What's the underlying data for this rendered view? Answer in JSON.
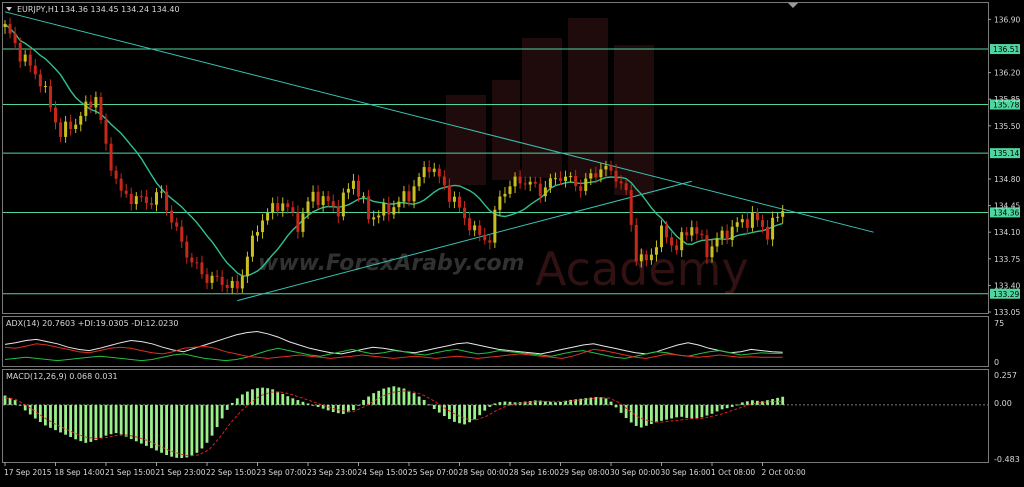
{
  "chart_data": [
    {
      "type": "candlestick",
      "title": "EURJPY,H1",
      "ohlc_readout": "134.36 134.45 134.24 134.40",
      "ylim": [
        133.05,
        137.05
      ],
      "y_ticks": [
        "136.90",
        "136.51",
        "136.20",
        "135.85",
        "135.78",
        "135.50",
        "135.14",
        "134.80",
        "134.45",
        "134.36",
        "134.10",
        "133.75",
        "133.40",
        "133.29",
        "133.05"
      ],
      "x_ticks": [
        "17 Sep 2015",
        "18 Sep 14:00",
        "21 Sep 15:00",
        "21 Sep 23:00",
        "22 Sep 15:00",
        "23 Sep 07:00",
        "23 Sep 23:00",
        "24 Sep 15:00",
        "25 Sep 07:00",
        "28 Sep 00:00",
        "28 Sep 16:00",
        "29 Sep 08:00",
        "30 Sep 00:00",
        "30 Sep 16:00",
        "1 Oct 08:00",
        "2 Oct 00:00"
      ],
      "horizontal_levels": [
        {
          "value": 136.51,
          "label": "136.51"
        },
        {
          "value": 135.78,
          "label": "135.78"
        },
        {
          "value": 135.14,
          "label": "135.14"
        },
        {
          "value": 134.36,
          "label": "134.36"
        },
        {
          "value": 133.29,
          "label": "133.29"
        }
      ],
      "trendlines": [
        {
          "from": [
            0,
            137.0
          ],
          "to": [
            172,
            134.1
          ]
        },
        {
          "from": [
            46,
            133.2
          ],
          "to": [
            136,
            134.77
          ]
        }
      ],
      "price_path": [
        [
          0,
          136.8
        ],
        [
          3,
          136.45
        ],
        [
          7,
          136.1
        ],
        [
          11,
          135.4
        ],
        [
          14,
          135.55
        ],
        [
          18,
          135.9
        ],
        [
          20,
          135.2
        ],
        [
          23,
          134.6
        ],
        [
          28,
          134.5
        ],
        [
          31,
          134.6
        ],
        [
          34,
          134.1
        ],
        [
          37,
          133.7
        ],
        [
          40,
          133.5
        ],
        [
          43,
          133.45
        ],
        [
          46,
          133.35
        ],
        [
          48,
          133.8
        ],
        [
          51,
          134.3
        ],
        [
          55,
          134.5
        ],
        [
          58,
          134.2
        ],
        [
          61,
          134.6
        ],
        [
          66,
          134.4
        ],
        [
          69,
          134.8
        ],
        [
          72,
          134.3
        ],
        [
          76,
          134.4
        ],
        [
          80,
          134.6
        ],
        [
          84,
          135.0
        ],
        [
          87,
          134.7
        ],
        [
          90,
          134.4
        ],
        [
          93,
          134.1
        ],
        [
          96,
          134.0
        ],
        [
          98,
          134.6
        ],
        [
          102,
          134.8
        ],
        [
          106,
          134.65
        ],
        [
          110,
          134.85
        ],
        [
          114,
          134.7
        ],
        [
          118,
          134.95
        ],
        [
          121,
          134.85
        ],
        [
          123,
          134.6
        ],
        [
          125,
          133.8
        ],
        [
          127,
          133.7
        ],
        [
          130,
          134.1
        ],
        [
          133,
          133.9
        ],
        [
          136,
          134.2
        ],
        [
          139,
          133.85
        ],
        [
          141,
          134.0
        ],
        [
          145,
          134.2
        ],
        [
          148,
          134.3
        ],
        [
          151,
          134.1
        ],
        [
          153,
          134.3
        ],
        [
          154,
          134.4
        ]
      ],
      "colors": {
        "up": "#c9c020",
        "down": "#c8281c",
        "ma": "#30c090",
        "levels": "#4fd6a0",
        "trend": "#3cc2b5"
      },
      "watermark_lines": [
        "www.ForexAraby.com",
        "Academy"
      ]
    },
    {
      "type": "line",
      "title": "ADX(14) 20.7603 +DI:19.0305 -DI:12.0230",
      "ylim": [
        0,
        75
      ],
      "y_ticks": [
        "75",
        "0"
      ],
      "series": [
        {
          "name": "ADX",
          "color": "#e8e8e8",
          "values": [
            35,
            38,
            42,
            44,
            40,
            36,
            30,
            26,
            24,
            28,
            33,
            38,
            42,
            40,
            36,
            30,
            25,
            22,
            28,
            34,
            40,
            46,
            52,
            56,
            58,
            54,
            48,
            40,
            34,
            28,
            24,
            20,
            18,
            22,
            26,
            30,
            28,
            25,
            22,
            20,
            24,
            28,
            32,
            36,
            38,
            34,
            30,
            26,
            24,
            22,
            20,
            18,
            22,
            26,
            30,
            34,
            36,
            32,
            28,
            24,
            20,
            18,
            22,
            28,
            34,
            38,
            34,
            28,
            24,
            20,
            22,
            26,
            24,
            22,
            21
          ]
        },
        {
          "name": "+DI",
          "color": "#20c040",
          "values": [
            8,
            10,
            12,
            10,
            8,
            6,
            8,
            10,
            12,
            14,
            12,
            10,
            8,
            6,
            8,
            12,
            16,
            18,
            14,
            10,
            8,
            6,
            8,
            12,
            18,
            24,
            28,
            24,
            20,
            16,
            14,
            18,
            22,
            26,
            22,
            18,
            20,
            24,
            22,
            18,
            16,
            20,
            24,
            26,
            22,
            18,
            20,
            24,
            22,
            20,
            18,
            16,
            14,
            18,
            22,
            24,
            20,
            16,
            12,
            10,
            14,
            18,
            22,
            20,
            16,
            14,
            18,
            22,
            24,
            20,
            16,
            18,
            20,
            19,
            19
          ]
        },
        {
          "name": "-DI",
          "color": "#e03020",
          "values": [
            30,
            28,
            32,
            36,
            34,
            30,
            26,
            22,
            20,
            24,
            28,
            30,
            28,
            24,
            20,
            18,
            22,
            28,
            30,
            32,
            28,
            22,
            18,
            14,
            12,
            10,
            12,
            14,
            16,
            14,
            12,
            10,
            12,
            14,
            16,
            14,
            12,
            10,
            12,
            14,
            12,
            10,
            12,
            14,
            12,
            10,
            12,
            14,
            16,
            18,
            16,
            14,
            12,
            10,
            14,
            20,
            26,
            24,
            20,
            16,
            12,
            10,
            14,
            18,
            16,
            14,
            12,
            14,
            16,
            14,
            12,
            13,
            12,
            12,
            12
          ]
        }
      ]
    },
    {
      "type": "bar",
      "title": "MACD(12,26,9) 0.068 0.031",
      "ylim": [
        -0.483,
        0.257
      ],
      "y_ticks": [
        "0.257",
        "0.00",
        "-0.483"
      ],
      "series": [
        {
          "name": "MACD",
          "color": "#9cf08c",
          "values": [
            0.08,
            0.04,
            -0.05,
            -0.12,
            -0.18,
            -0.22,
            -0.26,
            -0.3,
            -0.33,
            -0.3,
            -0.26,
            -0.24,
            -0.28,
            -0.32,
            -0.36,
            -0.4,
            -0.44,
            -0.46,
            -0.45,
            -0.4,
            -0.3,
            -0.15,
            0.0,
            0.08,
            0.13,
            0.15,
            0.14,
            0.1,
            0.06,
            0.03,
            0.0,
            -0.03,
            -0.06,
            -0.08,
            -0.05,
            0.04,
            0.1,
            0.14,
            0.16,
            0.14,
            0.1,
            0.04,
            -0.04,
            -0.1,
            -0.15,
            -0.17,
            -0.12,
            -0.04,
            0.02,
            0.03,
            0.02,
            0.03,
            0.04,
            0.03,
            0.02,
            0.04,
            0.05,
            0.06,
            0.07,
            0.05,
            -0.05,
            -0.14,
            -0.2,
            -0.17,
            -0.14,
            -0.12,
            -0.1,
            -0.12,
            -0.11,
            -0.08,
            -0.04,
            -0.02,
            0.02,
            0.04,
            0.03,
            0.05,
            0.07
          ]
        },
        {
          "name": "Signal",
          "color": "#e02020",
          "values": [
            0.06,
            0.05,
            0.0,
            -0.06,
            -0.12,
            -0.17,
            -0.21,
            -0.25,
            -0.28,
            -0.29,
            -0.28,
            -0.26,
            -0.26,
            -0.28,
            -0.31,
            -0.35,
            -0.39,
            -0.42,
            -0.44,
            -0.43,
            -0.38,
            -0.28,
            -0.16,
            -0.06,
            0.02,
            0.08,
            0.11,
            0.11,
            0.09,
            0.06,
            0.03,
            0.0,
            -0.03,
            -0.05,
            -0.06,
            -0.02,
            0.03,
            0.08,
            0.11,
            0.12,
            0.11,
            0.08,
            0.03,
            -0.03,
            -0.08,
            -0.12,
            -0.13,
            -0.1,
            -0.05,
            -0.01,
            0.01,
            0.02,
            0.03,
            0.03,
            0.03,
            0.03,
            0.04,
            0.05,
            0.06,
            0.06,
            0.02,
            -0.05,
            -0.11,
            -0.14,
            -0.15,
            -0.14,
            -0.13,
            -0.12,
            -0.12,
            -0.1,
            -0.08,
            -0.05,
            -0.02,
            0.01,
            0.02,
            0.03,
            0.03
          ]
        }
      ]
    }
  ]
}
